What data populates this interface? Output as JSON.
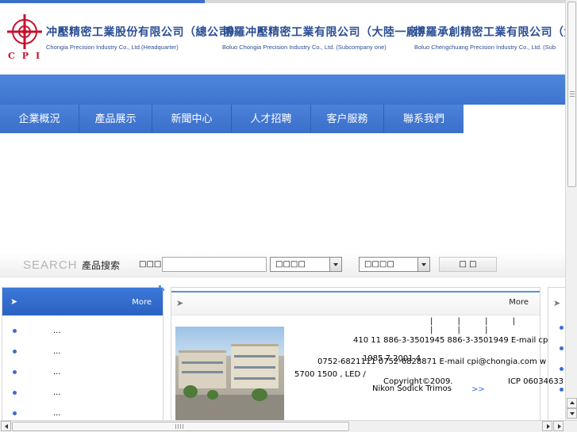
{
  "header": {
    "logo_letters": "CPI",
    "companies": [
      {
        "cn": "冲壓精密工業股份有限公司（總公司）",
        "en": "Chongia Precision Industry Co., Ltd.(Headquarter)"
      },
      {
        "cn": "博羅冲壓精密工業有限公司（大陸一廠）",
        "en": "Boluo Chongia Precision Industry Co., Ltd. (Subcompany one)"
      },
      {
        "cn": "博羅承創精密工業有限公司（大",
        "en": "Boluo Chengchuang Precision Industry Co., Ltd. (Sub"
      }
    ]
  },
  "nav": {
    "items": [
      "企業概況",
      "產品展示",
      "新聞中心",
      "人才招聘",
      "客户服務",
      "聯系我們"
    ]
  },
  "search": {
    "word": "SEARCH",
    "cn_label": "產品搜索",
    "keyword_label": "□□□□",
    "input_value": "",
    "select1": "□□□□",
    "select2": "□□□□",
    "button": "□ □"
  },
  "left_panel": {
    "arrow": "➤",
    "more": "More",
    "items": [
      "...",
      "...",
      "...",
      "...",
      "..."
    ]
  },
  "center_panel": {
    "arrow": "➤",
    "more": "More",
    "bars": "| | | | | | |",
    "lines": [
      "410 11     886-3-3501945    886-3-3501949  E-mail cp",
      "1985 7         2001 4",
      "0752-6821111   0752-6828871   E-mail cpi@chongia.com    w",
      "5700       1500  ,             LED                  /",
      "Copyright©2009.",
      "ICP 06034633",
      "Nikon Sodick   Trimos",
      ">>"
    ]
  },
  "colors": {
    "brand_blue": "#3b6fc8",
    "logo_red": "#c8102e"
  }
}
